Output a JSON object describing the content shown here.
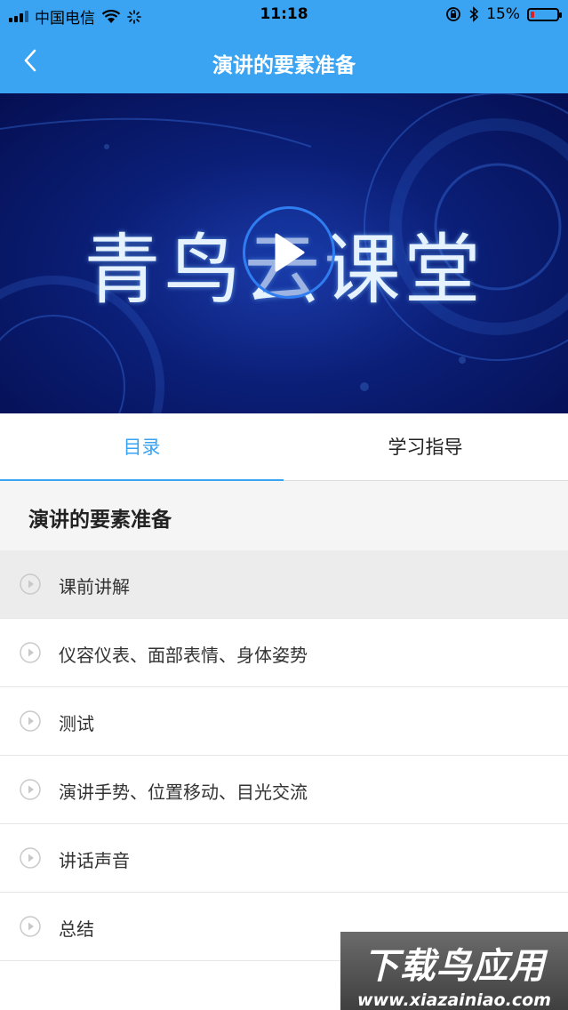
{
  "status_bar": {
    "carrier": "中国电信",
    "time": "11:18",
    "battery": "15%",
    "battery_level": 0.15,
    "icons": [
      "signal-icon",
      "wifi-icon",
      "loading-icon",
      "rotation-lock-icon",
      "bluetooth-icon",
      "battery-icon"
    ],
    "battery_color": "#e02020"
  },
  "nav": {
    "title": "演讲的要素准备",
    "back_icon": "chevron-left-icon",
    "bar_color": "#3aa3f2"
  },
  "video": {
    "brand_text": "青鸟云课堂",
    "play_icon": "play-icon"
  },
  "tabs": [
    {
      "label": "目录",
      "active": true
    },
    {
      "label": "学习指导",
      "active": false
    }
  ],
  "section": {
    "title": "演讲的要素准备"
  },
  "lessons": [
    {
      "label": "课前讲解",
      "active": true
    },
    {
      "label": "仪容仪表、面部表情、身体姿势",
      "active": false
    },
    {
      "label": "测试",
      "active": false
    },
    {
      "label": "演讲手势、位置移动、目光交流",
      "active": false
    },
    {
      "label": "讲话声音",
      "active": false
    },
    {
      "label": "总结",
      "active": false
    }
  ],
  "watermark": {
    "title": "下载鸟应用",
    "url": "www.xiazainiao.com"
  }
}
